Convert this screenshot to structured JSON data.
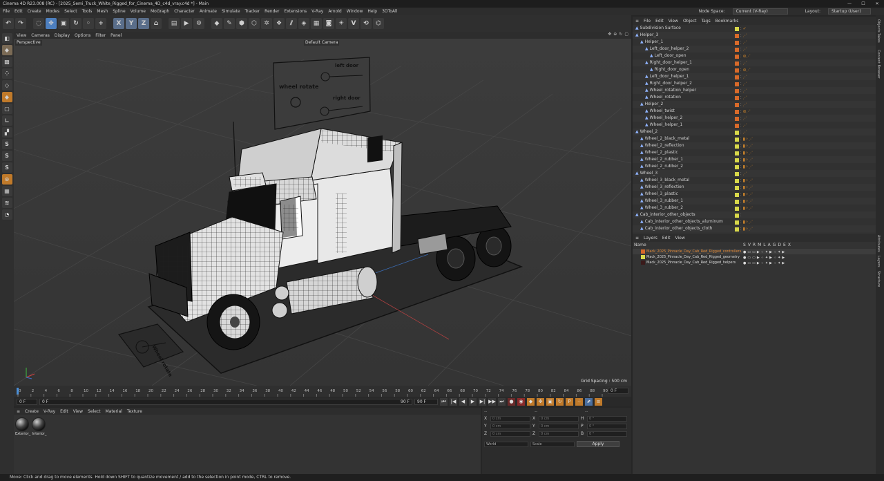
{
  "window": {
    "title": "Cinema 4D R23.008 (RC) - [2025_Semi_Truck_White_Rigged_for_Cinema_4D_c4d_vray.c4d *] - Main",
    "controls": [
      "—",
      "☐",
      "✕"
    ]
  },
  "menubar": {
    "items": [
      "File",
      "Edit",
      "Create",
      "Modes",
      "Select",
      "Tools",
      "Mesh",
      "Spline",
      "Volume",
      "MoGraph",
      "Character",
      "Animate",
      "Simulate",
      "Tracker",
      "Render",
      "Extensions",
      "V-Ray",
      "Arnold",
      "Window",
      "Help",
      "3DToAll"
    ],
    "node_space_label": "Node Space:",
    "node_space_value": "Current (V-Ray)",
    "layout_label": "Layout:",
    "layout_value": "Startup (User)"
  },
  "toolbar": {
    "buttons": [
      {
        "icon": "undo-icon",
        "glyph": "↶",
        "color": "#3a3a3a"
      },
      {
        "icon": "redo-icon",
        "glyph": "↷",
        "color": "#3a3a3a"
      },
      {
        "icon": "live-select-icon",
        "glyph": "◌",
        "color": "#3a3a3a"
      },
      {
        "icon": "move-icon",
        "glyph": "✥",
        "color": "#4d7fbf"
      },
      {
        "icon": "scale-icon",
        "glyph": "▣",
        "color": "#3a3a3a"
      },
      {
        "icon": "rotate-icon",
        "glyph": "↻",
        "color": "#3a3a3a"
      },
      {
        "icon": "recent-tools-icon",
        "glyph": "◦",
        "color": "#3a3a3a"
      },
      {
        "icon": "add-icon",
        "glyph": "+",
        "color": "#3a3a3a"
      },
      {
        "icon": "x-axis-icon",
        "glyph": "X",
        "color": "#5a6e8a"
      },
      {
        "icon": "y-axis-icon",
        "glyph": "Y",
        "color": "#5a6e8a"
      },
      {
        "icon": "z-axis-icon",
        "glyph": "Z",
        "color": "#5a6e8a"
      },
      {
        "icon": "coordinate-system-icon",
        "glyph": "⌂",
        "color": "#3a3a3a"
      },
      {
        "icon": "render-region-icon",
        "glyph": "▤",
        "color": "#3a3a3a"
      },
      {
        "icon": "render-view-icon",
        "glyph": "▶",
        "color": "#3a3a3a"
      },
      {
        "icon": "render-settings-icon",
        "glyph": "⚙",
        "color": "#3a3a3a"
      },
      {
        "icon": "cube-icon",
        "glyph": "◆",
        "color": "#3a3a3a"
      },
      {
        "icon": "pen-icon",
        "glyph": "✎",
        "color": "#3a3a3a"
      },
      {
        "icon": "subdivision-icon",
        "glyph": "⬢",
        "color": "#3a3a3a"
      },
      {
        "icon": "extrude-icon",
        "glyph": "⬡",
        "color": "#3a3a3a"
      },
      {
        "icon": "cloner-icon",
        "glyph": "✲",
        "color": "#3a3a3a"
      },
      {
        "icon": "mograph-icon",
        "glyph": "❖",
        "color": "#3a3a3a"
      },
      {
        "icon": "deformer-icon",
        "glyph": "⫽",
        "color": "#3a3a3a"
      },
      {
        "icon": "field-icon",
        "glyph": "◈",
        "color": "#3a3a3a"
      },
      {
        "icon": "floor-icon",
        "glyph": "▦",
        "color": "#3a3a3a"
      },
      {
        "icon": "camera-icon",
        "glyph": "◙",
        "color": "#3a3a3a"
      },
      {
        "icon": "light-icon",
        "glyph": "☀",
        "color": "#3a3a3a"
      },
      {
        "icon": "vray-icon",
        "glyph": "V",
        "color": "#3a3a3a"
      },
      {
        "icon": "vray-render-icon",
        "glyph": "⟲",
        "color": "#3a3a3a"
      },
      {
        "icon": "python-icon",
        "glyph": "⌬",
        "color": "#3a3a3a"
      }
    ]
  },
  "left_tools": [
    {
      "icon": "make-editable-icon",
      "glyph": "◧",
      "color": "#3a3a3a"
    },
    {
      "icon": "model-mode-icon",
      "glyph": "◆",
      "color": "#7a6a55"
    },
    {
      "icon": "texture-mode-icon",
      "glyph": "▩",
      "color": "#3a3a3a"
    },
    {
      "icon": "points-mode-icon",
      "glyph": "⁘",
      "color": "#3a3a3a"
    },
    {
      "icon": "edges-mode-icon",
      "glyph": "◇",
      "color": "#3a3a3a"
    },
    {
      "icon": "polygons-mode-icon",
      "glyph": "◆",
      "color": "#c07a2a"
    },
    {
      "icon": "uv-mode-icon",
      "glyph": "▢",
      "color": "#3a3a3a"
    },
    {
      "icon": "axis-mode-icon",
      "glyph": "∟",
      "color": "#3a3a3a"
    },
    {
      "icon": "snap-icon",
      "glyph": "▞",
      "color": "#3a3a3a"
    },
    {
      "icon": "solo-icon",
      "glyph": "S",
      "color": "#3a3a3a"
    },
    {
      "icon": "solo-hierarchy-icon",
      "glyph": "S",
      "color": "#3a3a3a"
    },
    {
      "icon": "solo-selection-icon",
      "glyph": "S",
      "color": "#3a3a3a"
    },
    {
      "icon": "workplane-icon",
      "glyph": "⊙",
      "color": "#c07a2a"
    },
    {
      "icon": "grid-icon",
      "glyph": "▦",
      "color": "#3a3a3a"
    },
    {
      "icon": "layers-tool-icon",
      "glyph": "≋",
      "color": "#3a3a3a"
    },
    {
      "icon": "lock-icon",
      "glyph": "◔",
      "color": "#3a3a3a"
    }
  ],
  "viewport": {
    "menu": [
      "View",
      "Cameras",
      "Display",
      "Options",
      "Filter",
      "Panel"
    ],
    "mode_label": "Perspective",
    "camera_label": "Default Camera",
    "grid_spacing": "Grid Spacing : 500 cm",
    "rig_labels": {
      "left_door": "left door",
      "right_door": "right door",
      "wheel_rotate": "wheel rotate",
      "wheel_base": "Wheel rotate"
    }
  },
  "timeline": {
    "ticks": [
      "0",
      "2",
      "4",
      "6",
      "8",
      "10",
      "12",
      "14",
      "16",
      "18",
      "20",
      "22",
      "24",
      "26",
      "28",
      "30",
      "32",
      "34",
      "36",
      "38",
      "40",
      "42",
      "44",
      "46",
      "48",
      "50",
      "52",
      "54",
      "56",
      "58",
      "60",
      "62",
      "64",
      "66",
      "68",
      "70",
      "72",
      "74",
      "76",
      "78",
      "80",
      "82",
      "84",
      "86",
      "88",
      "90"
    ],
    "current_frame": "0 F",
    "start_field": "0 F",
    "min_field": "0 F",
    "end_field": "90 F",
    "max_field": "90 F"
  },
  "material_manager": {
    "menu": [
      "Create",
      "V-Ray",
      "Edit",
      "View",
      "Select",
      "Material",
      "Texture"
    ],
    "materials": [
      {
        "label": "Exterior_"
      },
      {
        "label": "Interior_"
      }
    ]
  },
  "coordinates": {
    "header": [
      "--",
      "--",
      "--"
    ],
    "rows": [
      {
        "a": "X",
        "av": "0 cm",
        "b": "X",
        "bv": "0 cm",
        "c": "H",
        "cv": "0 °"
      },
      {
        "a": "Y",
        "av": "0 cm",
        "b": "Y",
        "bv": "0 cm",
        "c": "P",
        "cv": "0 °"
      },
      {
        "a": "Z",
        "av": "0 cm",
        "b": "Z",
        "bv": "0 cm",
        "c": "B",
        "cv": "0 °"
      }
    ],
    "world": "World",
    "scale": "Scale",
    "apply": "Apply"
  },
  "object_manager": {
    "menu": [
      "File",
      "Edit",
      "View",
      "Object",
      "Tags",
      "Bookmarks"
    ],
    "rows": [
      {
        "name": "Subdivision Surface",
        "level": 0,
        "color": "#d8d84a",
        "tags": "✓"
      },
      {
        "name": "Helper_3",
        "level": 0,
        "color": "#d86a2a",
        "tags": "⋰"
      },
      {
        "name": "Helper_1",
        "level": 1,
        "color": "#d86a2a",
        "tags": "⋰"
      },
      {
        "name": "Left_door_helper_2",
        "level": 2,
        "color": "#d86a2a",
        "tags": "⋰"
      },
      {
        "name": "Left_door_open",
        "level": 3,
        "color": "#d86a2a",
        "tags": "⊘⋰"
      },
      {
        "name": "Right_door_helper_1",
        "level": 2,
        "color": "#d86a2a",
        "tags": "⋰"
      },
      {
        "name": "Right_door_open",
        "level": 3,
        "color": "#d86a2a",
        "tags": "⊘⋰"
      },
      {
        "name": "Left_door_helper_1",
        "level": 2,
        "color": "#d86a2a",
        "tags": "⋰"
      },
      {
        "name": "Right_door_helper_2",
        "level": 2,
        "color": "#d86a2a",
        "tags": "⋰"
      },
      {
        "name": "Wheel_rotation_helper",
        "level": 2,
        "color": "#d86a2a",
        "tags": "⋰"
      },
      {
        "name": "Wheel_rotation",
        "level": 2,
        "color": "#d86a2a",
        "tags": "⋰"
      },
      {
        "name": "Helper_2",
        "level": 1,
        "color": "#d86a2a",
        "tags": "⋰"
      },
      {
        "name": "Wheel_twist",
        "level": 2,
        "color": "#d86a2a",
        "tags": "⊘⋰"
      },
      {
        "name": "Wheel_helper_2",
        "level": 2,
        "color": "#d86a2a",
        "tags": "⋰"
      },
      {
        "name": "Wheel_helper_1",
        "level": 2,
        "color": "#d86a2a",
        "tags": "⋰"
      },
      {
        "name": "Wheel_2",
        "level": 0,
        "color": "#d8d84a",
        "tags": "⋰"
      },
      {
        "name": "Wheel_2_black_metal",
        "level": 1,
        "color": "#d8d84a",
        "tags": "▮⁘⋰"
      },
      {
        "name": "Wheel_2_reflection",
        "level": 1,
        "color": "#d8d84a",
        "tags": "▮⁘⋰"
      },
      {
        "name": "Wheel_2_plastic",
        "level": 1,
        "color": "#d8d84a",
        "tags": "▮⁘⋰"
      },
      {
        "name": "Wheel_2_rubber_1",
        "level": 1,
        "color": "#d8d84a",
        "tags": "▮⁘⋰"
      },
      {
        "name": "Wheel_2_rubber_2",
        "level": 1,
        "color": "#d8d84a",
        "tags": "▮⁘⋰"
      },
      {
        "name": "Wheel_3",
        "level": 0,
        "color": "#d8d84a",
        "tags": "⋰"
      },
      {
        "name": "Wheel_3_black_metal",
        "level": 1,
        "color": "#d8d84a",
        "tags": "▮⁘⋰"
      },
      {
        "name": "Wheel_3_reflection",
        "level": 1,
        "color": "#d8d84a",
        "tags": "▮⁘⋰"
      },
      {
        "name": "Wheel_3_plastic",
        "level": 1,
        "color": "#d8d84a",
        "tags": "▮⁘⋰"
      },
      {
        "name": "Wheel_3_rubber_1",
        "level": 1,
        "color": "#d8d84a",
        "tags": "▮⁘⋰"
      },
      {
        "name": "Wheel_3_rubber_2",
        "level": 1,
        "color": "#d8d84a",
        "tags": "▮⁘⋰"
      },
      {
        "name": "Cab_interior_other_objects",
        "level": 0,
        "color": "#d8d84a",
        "tags": ""
      },
      {
        "name": "Cab_interior_other_objects_aluminum",
        "level": 1,
        "color": "#d8d84a",
        "tags": "▮⁘⋰"
      },
      {
        "name": "Cab_interior_other_objects_cloth",
        "level": 1,
        "color": "#d8d84a",
        "tags": "▮⁘⋰"
      }
    ]
  },
  "layer_manager": {
    "menu": [
      "Layers",
      "Edit",
      "View"
    ],
    "header_name": "Name",
    "header_flags": [
      "S",
      "V",
      "R",
      "M",
      "L",
      "A",
      "G",
      "D",
      "E",
      "X"
    ],
    "layers": [
      {
        "name": "Mack_2025_Pinnacle_Day_Cab_Red_Rigged_controllers",
        "color": "#d86a2a"
      },
      {
        "name": "Mack_2025_Pinnacle_Day_Cab_Red_Rigged_geometry",
        "color": "#d8d84a"
      },
      {
        "name": "Mack_2025_Pinnacle_Day_Cab_Red_Rigged_helpers",
        "color": "#3a1a1a"
      }
    ]
  },
  "side_tabs": [
    "Objects",
    "Takes",
    "Content Browser",
    "Attributes",
    "Layers",
    "Structure"
  ],
  "status": "Move: Click and drag to move elements. Hold down SHIFT to quantize movement / add to the selection in point mode, CTRL to remove."
}
